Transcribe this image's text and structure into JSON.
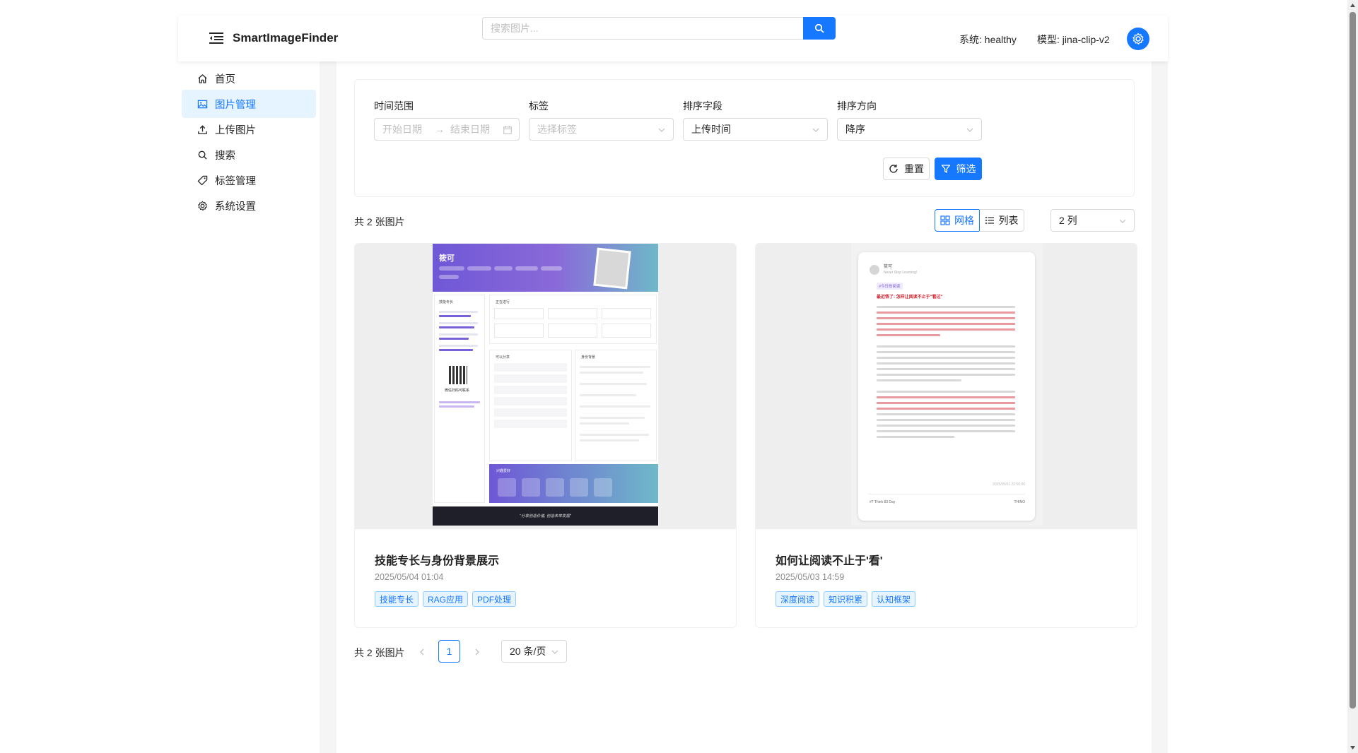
{
  "header": {
    "title": "SmartImageFinder",
    "search_placeholder": "搜索图片...",
    "status_text": "系统: healthy",
    "model_text": "模型: jina-clip-v2"
  },
  "sidebar": {
    "items": [
      {
        "label": "首页",
        "icon": "home-icon"
      },
      {
        "label": "图片管理",
        "icon": "picture-icon",
        "active": true
      },
      {
        "label": "上传图片",
        "icon": "upload-icon"
      },
      {
        "label": "搜索",
        "icon": "search-icon"
      },
      {
        "label": "标签管理",
        "icon": "tag-icon"
      },
      {
        "label": "系统设置",
        "icon": "gear-icon"
      }
    ]
  },
  "filters": {
    "time_range_label": "时间范围",
    "start_placeholder": "开始日期",
    "end_placeholder": "结束日期",
    "tags_label": "标签",
    "tags_placeholder": "选择标签",
    "sort_field_label": "排序字段",
    "sort_field_value": "上传时间",
    "sort_dir_label": "排序方向",
    "sort_dir_value": "降序",
    "reset_label": "重置",
    "filter_label": "筛选"
  },
  "toolbar": {
    "count_text": "共 2 张图片",
    "grid_label": "网格",
    "list_label": "列表",
    "columns_value": "2 列"
  },
  "cards": [
    {
      "title": "技能专长与身份背景展示",
      "date": "2025/05/04 01:04",
      "tags": [
        "技能专长",
        "RAG应用",
        "PDF处理"
      ],
      "thumb": {
        "name": "筱可",
        "sections": [
          "技能专长",
          "正在进行",
          "可以分享",
          "身份背景",
          "兴趣爱好"
        ],
        "footer": "\"分享创造价值, 创造未来发掘\"",
        "qr_caption": "微信扫码可联系"
      }
    },
    {
      "title": "如何让阅读不止于'看'",
      "date": "2025/05/03 14:59",
      "tags": [
        "深度阅读",
        "知识积累",
        "认知框架"
      ],
      "thumb": {
        "author": "筱可",
        "subtitle": "Never Stop Learning!",
        "badge": "#今日份阅读",
        "heading": "最近悟了: 怎样让阅读不止于\"看过\"",
        "stamp": "2025/05/01 22:50:00",
        "footer_left": "#7 Think 83 Day",
        "footer_right": "THINO"
      }
    }
  ],
  "pagination": {
    "total_text": "共 2 张图片",
    "current_page": "1",
    "page_size": "20 条/页"
  },
  "colors": {
    "primary": "#1677ff",
    "active_bg": "#e6f4ff",
    "tag_border": "#91caff"
  }
}
